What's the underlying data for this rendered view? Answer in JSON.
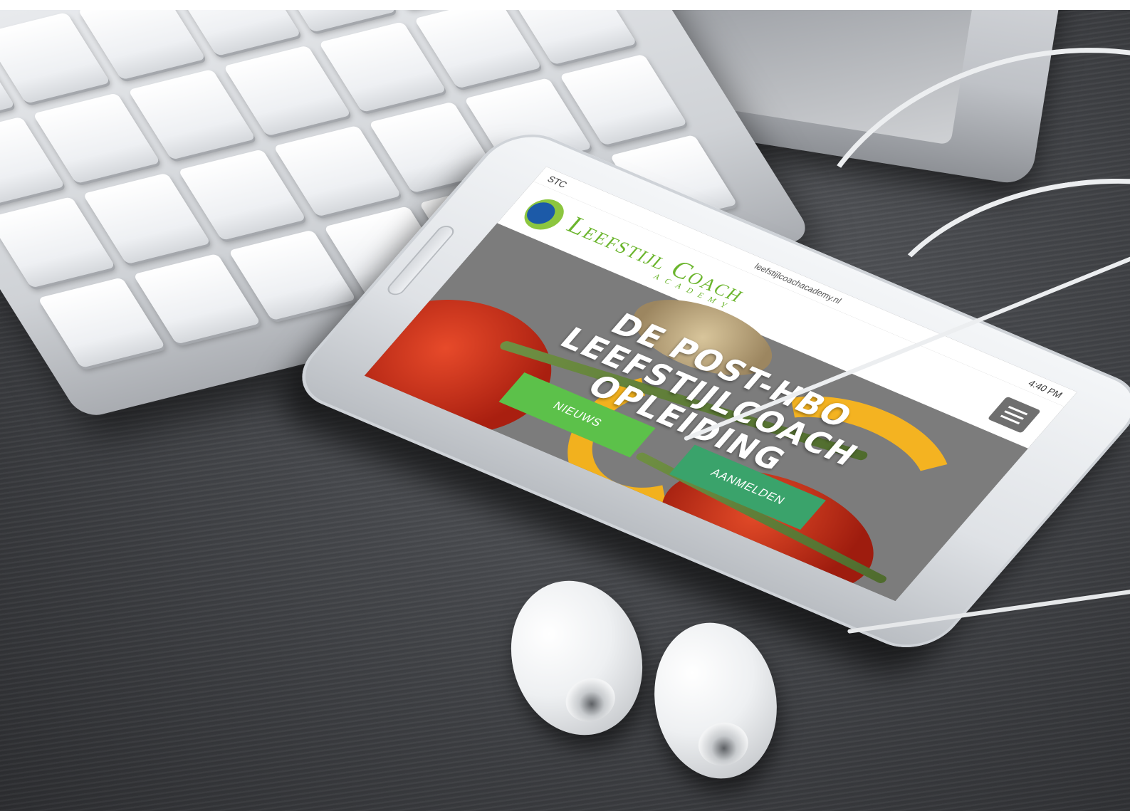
{
  "phone": {
    "status": {
      "carrier": "STC",
      "time": "4:40 PM",
      "url": "leefstijlcoachacademy.nl"
    },
    "header": {
      "logo_main": "Leefstijl Coach",
      "logo_sub": "ACADEMY",
      "menu_icon": "hamburger-icon"
    },
    "hero": {
      "title_line1": "DE POST-HBO",
      "title_line2": "LEEFSTIJLCOACH",
      "title_line3": "OPLEIDING",
      "button_news": "NIEUWS",
      "button_register": "AANMELDEN"
    }
  },
  "colors": {
    "brand_green": "#6bb52d",
    "brand_blue": "#1c5aa8",
    "button_news": "#5cc14a",
    "button_register": "#3aa36b"
  }
}
